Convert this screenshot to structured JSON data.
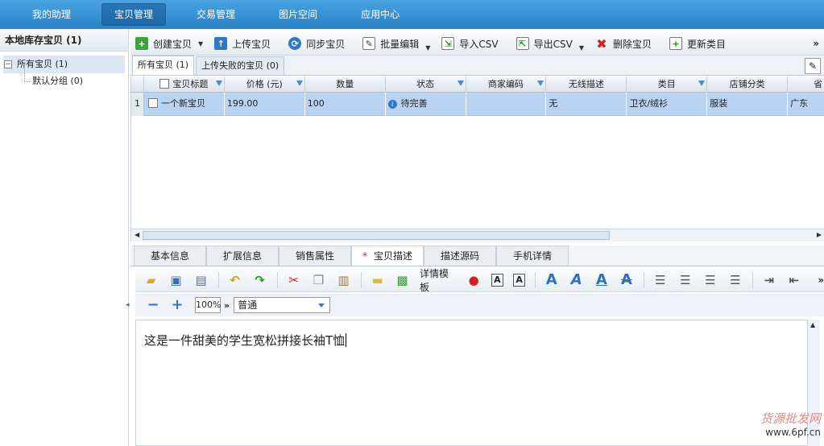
{
  "topnav": [
    "我的助理",
    "宝贝管理",
    "交易管理",
    "图片空间",
    "应用中心"
  ],
  "left": {
    "title": "本地库存宝贝 (1)",
    "root": "所有宝贝 (1)",
    "child": "默认分组 (0)"
  },
  "toolbar": [
    {
      "label": "创建宝贝",
      "icon": "add-icon",
      "dropdown": true
    },
    {
      "label": "上传宝贝",
      "icon": "upload-icon",
      "dropdown": false
    },
    {
      "label": "同步宝贝",
      "icon": "sync-icon",
      "dropdown": false
    },
    {
      "label": "批量编辑",
      "icon": "batch-edit-icon",
      "dropdown": true
    },
    {
      "label": "导入CSV",
      "icon": "import-icon",
      "dropdown": false
    },
    {
      "label": "导出CSV",
      "icon": "export-icon",
      "dropdown": true
    },
    {
      "label": "删除宝贝",
      "icon": "delete-icon",
      "dropdown": false
    },
    {
      "label": "更新类目",
      "icon": "update-icon",
      "dropdown": false
    }
  ],
  "toolbar_more": "»",
  "subtabs": [
    "所有宝贝 (1)",
    "上传失败的宝贝 (0)"
  ],
  "grid": {
    "columns": [
      "宝贝标题",
      "价格 (元)",
      "数量",
      "状态",
      "商家编码",
      "无线描述",
      "类目",
      "店铺分类",
      "省"
    ],
    "rows": [
      {
        "num": "1",
        "title": "一个新宝贝",
        "price": "199.00",
        "qty": "100",
        "status": "待完善",
        "code": "",
        "wireless": "无",
        "category": "卫衣/绒衫",
        "shop_cat": "服装",
        "province": "广东"
      }
    ]
  },
  "bottom_tabs": [
    "基本信息",
    "扩展信息",
    "销售属性",
    "宝贝描述",
    "描述源码",
    "手机详情"
  ],
  "editor": {
    "template_label": "详情模板",
    "zoom": "100%",
    "style": "普通",
    "content": "这是一件甜美的学生宽松拼接长袖T恤"
  },
  "watermark": {
    "line1": "货源批发网",
    "line2": "www.6pf.cn"
  }
}
